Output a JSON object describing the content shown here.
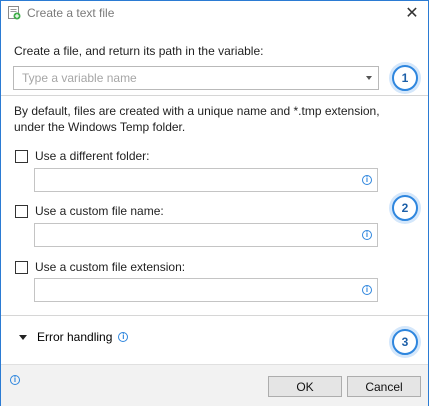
{
  "window": {
    "title": "Create a text file",
    "close_glyph": "✕"
  },
  "section1": {
    "label": "Create a file, and return its path in the variable:",
    "variable_placeholder": "Type a variable name",
    "badge": "1"
  },
  "section2": {
    "description": "By default, files are created with a unique name and *.tmp extension, under the Windows Temp folder.",
    "options": [
      {
        "label": "Use a different folder:",
        "checked": false,
        "value": ""
      },
      {
        "label": "Use a custom file name:",
        "checked": false,
        "value": ""
      },
      {
        "label": "Use a custom file extension:",
        "checked": false,
        "value": ""
      }
    ],
    "badge": "2"
  },
  "section3": {
    "error_handling_label": "Error handling",
    "badge": "3"
  },
  "footer": {
    "ok_label": "OK",
    "cancel_label": "Cancel"
  },
  "icons": {
    "info": "i"
  },
  "colors": {
    "accent": "#2e86de",
    "window_border": "#2b7bd3",
    "footer_bg": "#f2f2f2"
  }
}
